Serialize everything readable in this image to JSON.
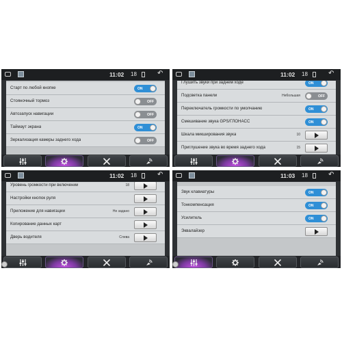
{
  "panels": [
    {
      "status": {
        "time": "11:02",
        "volume": "18"
      },
      "rows": [
        {
          "label": "Старт по любой кнопке",
          "control": "toggle",
          "state": "ON"
        },
        {
          "label": "Стояночный тормоз",
          "control": "toggle",
          "state": "OFF"
        },
        {
          "label": "Автозапуск навигации",
          "control": "toggle",
          "state": "OFF"
        },
        {
          "label": "Таймаут экрана",
          "control": "toggle",
          "state": "ON"
        },
        {
          "label": "Зеркализация камеры заднего хода",
          "control": "toggle",
          "state": "OFF"
        }
      ],
      "active_tab": 1
    },
    {
      "status": {
        "time": "11:02",
        "volume": "18"
      },
      "rows": [
        {
          "label": "Глушить звуки при заднем ходе",
          "control": "toggle",
          "state": "ON"
        },
        {
          "label": "Подсветка панели",
          "control": "toggle",
          "state": "OFF",
          "value": "Небольшая"
        },
        {
          "label": "Переключатель громкости по умолчанию",
          "control": "toggle",
          "state": "ON"
        },
        {
          "label": "Смешивание звука GPS/ГЛОНАСС",
          "control": "toggle",
          "state": "ON"
        },
        {
          "label": "Шкала микширования звука",
          "control": "play",
          "value": "10"
        },
        {
          "label": "Приглушение звука во время заднего хода",
          "control": "play",
          "value": "15"
        }
      ],
      "active_tab": 1
    },
    {
      "status": {
        "time": "11:02",
        "volume": "18"
      },
      "rows": [
        {
          "label": "Уровень громкости при включении",
          "control": "play",
          "value": "18"
        },
        {
          "label": "Настройки кнопок руля",
          "control": "play"
        },
        {
          "label": "Приложение для навигации",
          "control": "play",
          "value": "Не задано"
        },
        {
          "label": "Копирование данных карт",
          "control": "play"
        },
        {
          "label": "Дверь водителя",
          "control": "play",
          "value": "Слева"
        }
      ],
      "active_tab": 1
    },
    {
      "status": {
        "time": "11:03",
        "volume": "18"
      },
      "rows": [
        {
          "label": "Звук клавиатуры",
          "control": "toggle",
          "state": "ON"
        },
        {
          "label": "Тонкомпенсация",
          "control": "toggle",
          "state": "ON"
        },
        {
          "label": "Усилитель",
          "control": "toggle",
          "state": "ON"
        },
        {
          "label": "Эквалайзер",
          "control": "play"
        }
      ],
      "active_tab": 0
    }
  ],
  "nav_icons": [
    "sliders-icon",
    "gear-icon",
    "tools-icon",
    "satellite-icon"
  ]
}
